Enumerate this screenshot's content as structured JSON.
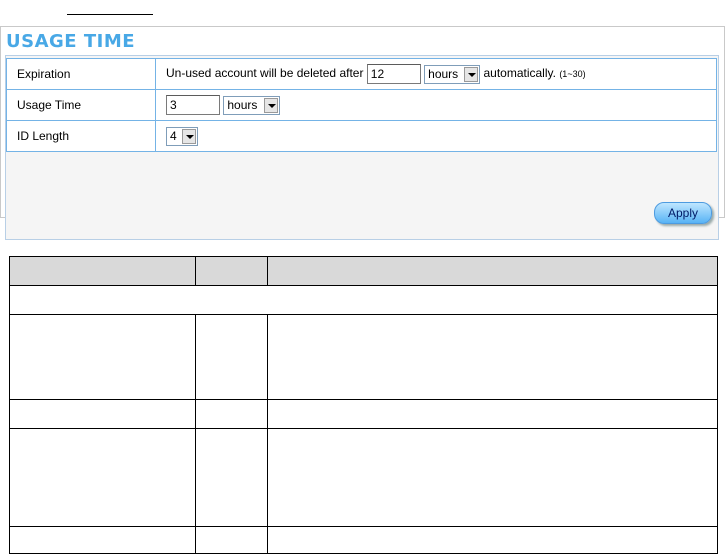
{
  "panel": {
    "title": "USAGE TIME",
    "apply_label": "Apply"
  },
  "rows": {
    "expiration": {
      "label": "Expiration",
      "prefix": "Un-used account will be deleted after",
      "value": "12",
      "unit": "hours",
      "suffix": "automatically.",
      "range_hint": "(1~30)"
    },
    "usage_time": {
      "label": "Usage Time",
      "value": "3",
      "unit": "hours"
    },
    "id_length": {
      "label": "ID Length",
      "value": "4"
    }
  },
  "doc_table": {
    "header": [
      "",
      "",
      ""
    ],
    "rows": [
      [
        "",
        "",
        ""
      ],
      [
        "",
        "",
        ""
      ],
      [
        "",
        "",
        ""
      ],
      [
        "",
        "",
        ""
      ]
    ]
  }
}
